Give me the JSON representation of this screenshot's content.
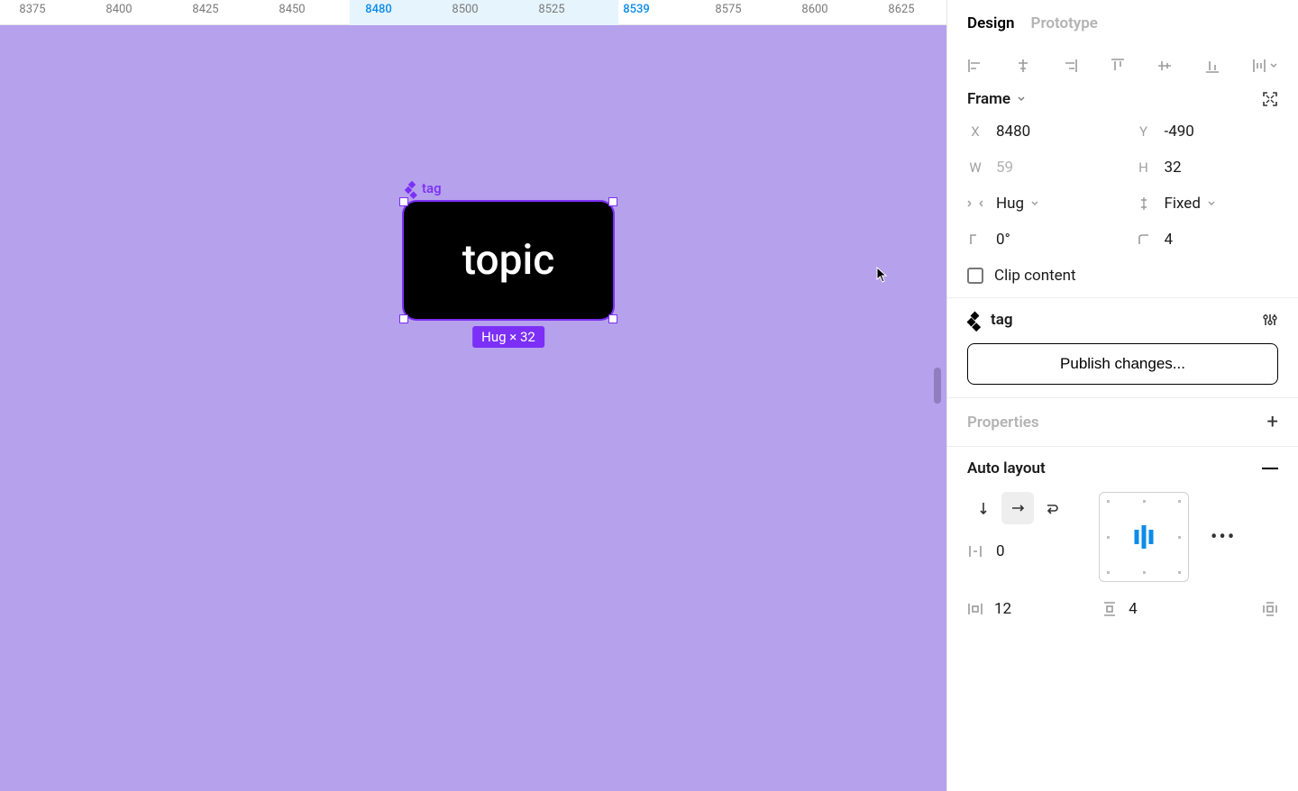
{
  "ruler": {
    "ticks": [
      {
        "label": "8375",
        "pos": 36,
        "blue": false
      },
      {
        "label": "8400",
        "pos": 132,
        "blue": false
      },
      {
        "label": "8425",
        "pos": 228,
        "blue": false
      },
      {
        "label": "8450",
        "pos": 324,
        "blue": false
      },
      {
        "label": "8480",
        "pos": 420,
        "blue": true
      },
      {
        "label": "8500",
        "pos": 516,
        "blue": false
      },
      {
        "label": "8525",
        "pos": 612,
        "blue": false
      },
      {
        "label": "8539",
        "pos": 706,
        "blue": true
      },
      {
        "label": "8575",
        "pos": 808,
        "blue": false
      },
      {
        "label": "8600",
        "pos": 904,
        "blue": false
      },
      {
        "label": "8625",
        "pos": 1000,
        "blue": false
      }
    ],
    "highlight_start": 388,
    "highlight_end": 686
  },
  "canvas": {
    "frame_label": "tag",
    "frame_text": "topic",
    "selection_badge": "Hug × 32"
  },
  "panel": {
    "tabs": {
      "design": "Design",
      "prototype": "Prototype"
    },
    "frame": {
      "title": "Frame",
      "x_label": "X",
      "x": "8480",
      "y_label": "Y",
      "y": "-490",
      "w_label": "W",
      "w": "59",
      "h_label": "H",
      "h": "32",
      "hsize": "Hug",
      "vsize": "Fixed",
      "rotation": "0°",
      "radius": "4",
      "clip_label": "Clip content"
    },
    "component": {
      "name": "tag",
      "publish_btn": "Publish changes..."
    },
    "properties": {
      "title": "Properties"
    },
    "autolayout": {
      "title": "Auto layout",
      "gap": "0",
      "pad_h": "12",
      "pad_v": "4"
    }
  }
}
